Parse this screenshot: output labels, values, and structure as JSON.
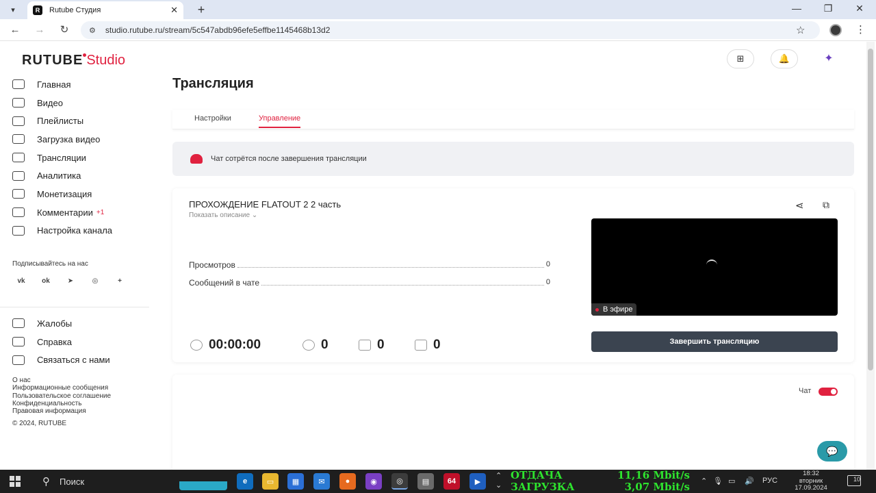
{
  "browser": {
    "tab_title": "Rutube Студия",
    "favicon": "R",
    "url": "studio.rutube.ru/stream/5c547abdb96efe5effbe1145468b13d2"
  },
  "header": {
    "logo_main": "RUTUBE",
    "logo_studio": "Studio"
  },
  "sidebar": {
    "items": [
      {
        "label": "Главная",
        "icon": "home-icon"
      },
      {
        "label": "Видео",
        "icon": "video-icon"
      },
      {
        "label": "Плейлисты",
        "icon": "playlist-icon"
      },
      {
        "label": "Загрузка видео",
        "icon": "upload-icon"
      },
      {
        "label": "Трансляции",
        "icon": "broadcast-icon"
      },
      {
        "label": "Аналитика",
        "icon": "analytics-icon"
      },
      {
        "label": "Монетизация",
        "icon": "monetization-icon"
      },
      {
        "label": "Комментарии",
        "icon": "comments-icon",
        "badge": "+1"
      },
      {
        "label": "Настройка канала",
        "icon": "channel-settings-icon"
      }
    ],
    "follow_label": "Подписывайтесь на нас",
    "socials": [
      "vk",
      "ok",
      "telegram",
      "viber",
      "more"
    ],
    "bottom_items": [
      {
        "label": "Жалобы",
        "icon": "flag-icon"
      },
      {
        "label": "Справка",
        "icon": "help-icon"
      },
      {
        "label": "Связаться с нами",
        "icon": "contact-icon"
      }
    ],
    "footer_links": [
      "О нас",
      "Информационные сообщения",
      "Пользовательское соглашение",
      "Конфиденциальность",
      "Правовая информация"
    ],
    "copyright": "© 2024, RUTUBE"
  },
  "main": {
    "title": "Трансляция",
    "tabs": [
      {
        "label": "Настройки",
        "active": false
      },
      {
        "label": "Управление",
        "active": true
      }
    ],
    "notice": "Чат сотрётся после завершения трансляции",
    "stream": {
      "title": "ПРОХОЖДЕНИЕ FLATOUT 2 2 часть",
      "show_description": "Показать описание",
      "stats": [
        {
          "label": "Просмотров",
          "value": "0"
        },
        {
          "label": "Сообщений в чате",
          "value": "0"
        }
      ],
      "timer": "00:00:00",
      "viewers": "0",
      "likes": "0",
      "dislikes": "0",
      "live_label": "В эфире",
      "end_button": "Завершить трансляцию"
    },
    "chat_label": "Чат",
    "chat_enabled": true
  },
  "taskbar": {
    "search_label": "Поиск",
    "net_upload_label": "ОТДАЧА",
    "net_download_label": "ЗАГРУЗКА",
    "net_upload_value": "11,16 Mbit/s",
    "net_download_value": "3,07 Mbit/s",
    "app_badge_64": "64",
    "lang": "РУС",
    "time": "18:32",
    "weekday": "вторник",
    "date": "17.09.2024",
    "notifications_count": "10"
  },
  "colors": {
    "accent": "#e0213f",
    "button_dark": "#3b4450",
    "fab": "#2a9aa8",
    "net_text": "#2ee42e"
  }
}
